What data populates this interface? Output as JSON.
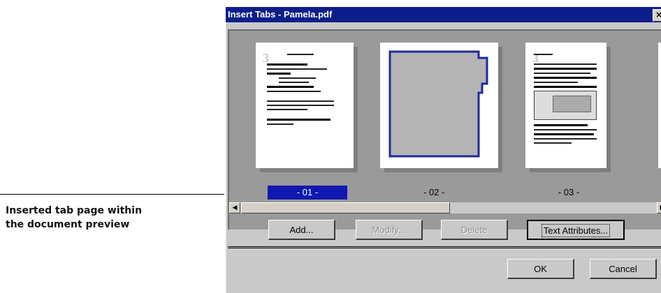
{
  "callout": {
    "line1": "Inserted tab page within",
    "line2": "the document preview"
  },
  "dialog": {
    "title": "Insert Tabs - Pamela.pdf",
    "close_glyph": "×"
  },
  "pages": [
    {
      "label": "- 01 -",
      "selected": true,
      "kind": "document"
    },
    {
      "label": "- 02 -",
      "selected": false,
      "kind": "tab"
    },
    {
      "label": "- 03 -",
      "selected": false,
      "kind": "document"
    }
  ],
  "page_doc_marker": "3",
  "scrollbar": {
    "left_glyph": "◀",
    "right_glyph": "▶"
  },
  "buttons": {
    "add": "Add...",
    "modify": "Modify...",
    "delete": "Delete",
    "text_attributes": "Text Attributes...",
    "ok": "OK",
    "cancel": "Cancel"
  },
  "colors": {
    "titlebar": "#0b1e8a",
    "selection": "#1018b0",
    "tab_outline": "#1f2a9a"
  }
}
